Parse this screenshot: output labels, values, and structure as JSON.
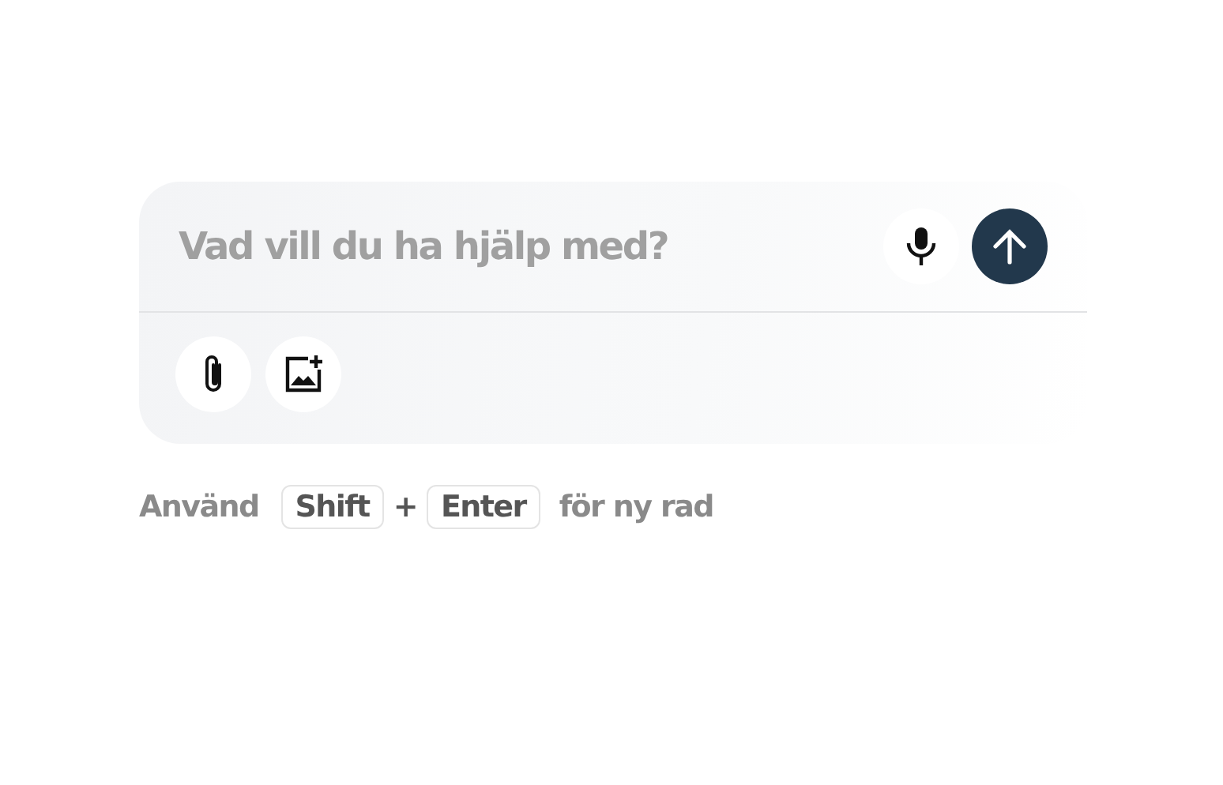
{
  "composer": {
    "placeholder": "Vad vill du ha hjälp med?"
  },
  "hint": {
    "prefix": "Använd",
    "keys": [
      "Shift",
      "Enter"
    ],
    "separator": "+",
    "suffix": "för ny rad"
  }
}
